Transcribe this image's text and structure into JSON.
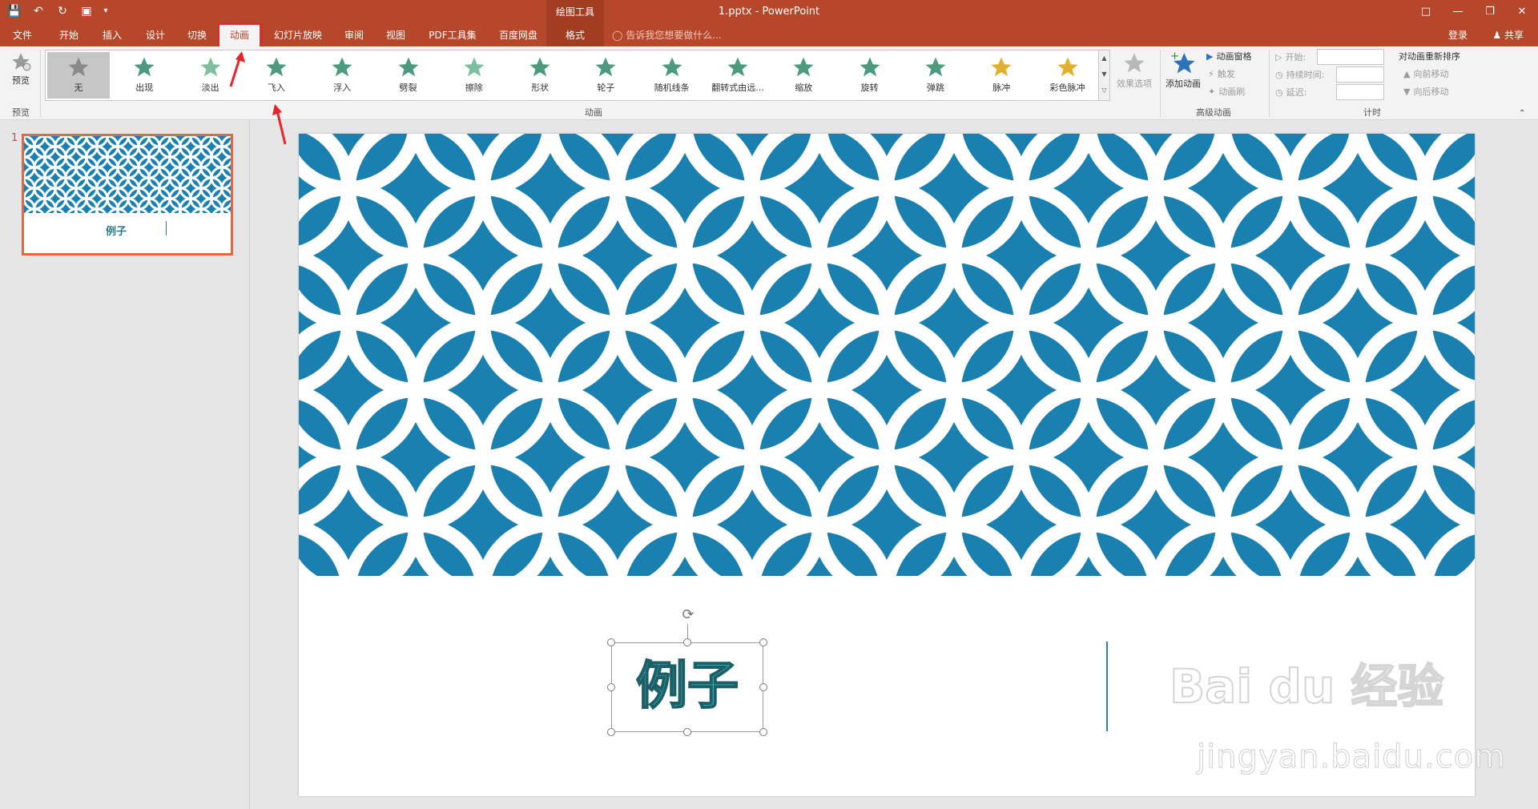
{
  "window": {
    "doc_title": "1.pptx - PowerPoint",
    "context_group": "绘图工具",
    "qat_icons": [
      "save-icon",
      "undo-icon",
      "redo-icon",
      "present-icon",
      "customize-icon"
    ]
  },
  "tabs": [
    {
      "label": "文件"
    },
    {
      "label": "开始"
    },
    {
      "label": "插入"
    },
    {
      "label": "设计"
    },
    {
      "label": "切换"
    },
    {
      "label": "动画"
    },
    {
      "label": "幻灯片放映"
    },
    {
      "label": "审阅"
    },
    {
      "label": "视图"
    },
    {
      "label": "PDF工具集"
    },
    {
      "label": "百度网盘"
    },
    {
      "label": "格式"
    }
  ],
  "active_tab": "动画",
  "tellme": "告诉我您想要做什么...",
  "account": {
    "login": "登录",
    "share": "共享"
  },
  "ribbon": {
    "preview_label": "预览",
    "preview_group": "预览",
    "animation_group": "动画",
    "effects": [
      {
        "label": "无",
        "color": "#8a8a8a"
      },
      {
        "label": "出现",
        "color": "#4e9a7c"
      },
      {
        "label": "淡出",
        "color": "#7fbf9f"
      },
      {
        "label": "飞入",
        "color": "#4e9a7c"
      },
      {
        "label": "浮入",
        "color": "#4e9a7c"
      },
      {
        "label": "劈裂",
        "color": "#4e9a7c"
      },
      {
        "label": "擦除",
        "color": "#7fbf9f"
      },
      {
        "label": "形状",
        "color": "#4e9a7c"
      },
      {
        "label": "轮子",
        "color": "#4e9a7c"
      },
      {
        "label": "随机线条",
        "color": "#4e9a7c"
      },
      {
        "label": "翻转式由远...",
        "color": "#4e9a7c"
      },
      {
        "label": "缩放",
        "color": "#4e9a7c"
      },
      {
        "label": "旋转",
        "color": "#4e9a7c"
      },
      {
        "label": "弹跳",
        "color": "#4e9a7c"
      },
      {
        "label": "脉冲",
        "color": "#e0b030"
      },
      {
        "label": "彩色脉冲",
        "color": "#e0b030"
      }
    ],
    "effect_options": "效果选项",
    "add_animation": "添加动画",
    "animation_pane": "动画窗格",
    "trigger": "触发",
    "animation_painter": "动画刷",
    "advanced_group": "高级动画",
    "start_label": "开始:",
    "duration_label": "持续时间:",
    "delay_label": "延迟:",
    "reorder_title": "对动画重新排序",
    "move_earlier": "向前移动",
    "move_later": "向后移动",
    "timing_group": "计时"
  },
  "thumbnails": [
    {
      "number": "1",
      "title": "例子"
    }
  ],
  "slide": {
    "text": "例子",
    "pattern_color": "#1a80b0"
  },
  "watermark": {
    "logo": "Bai du 经验",
    "url": "jingyan.baidu.com"
  }
}
